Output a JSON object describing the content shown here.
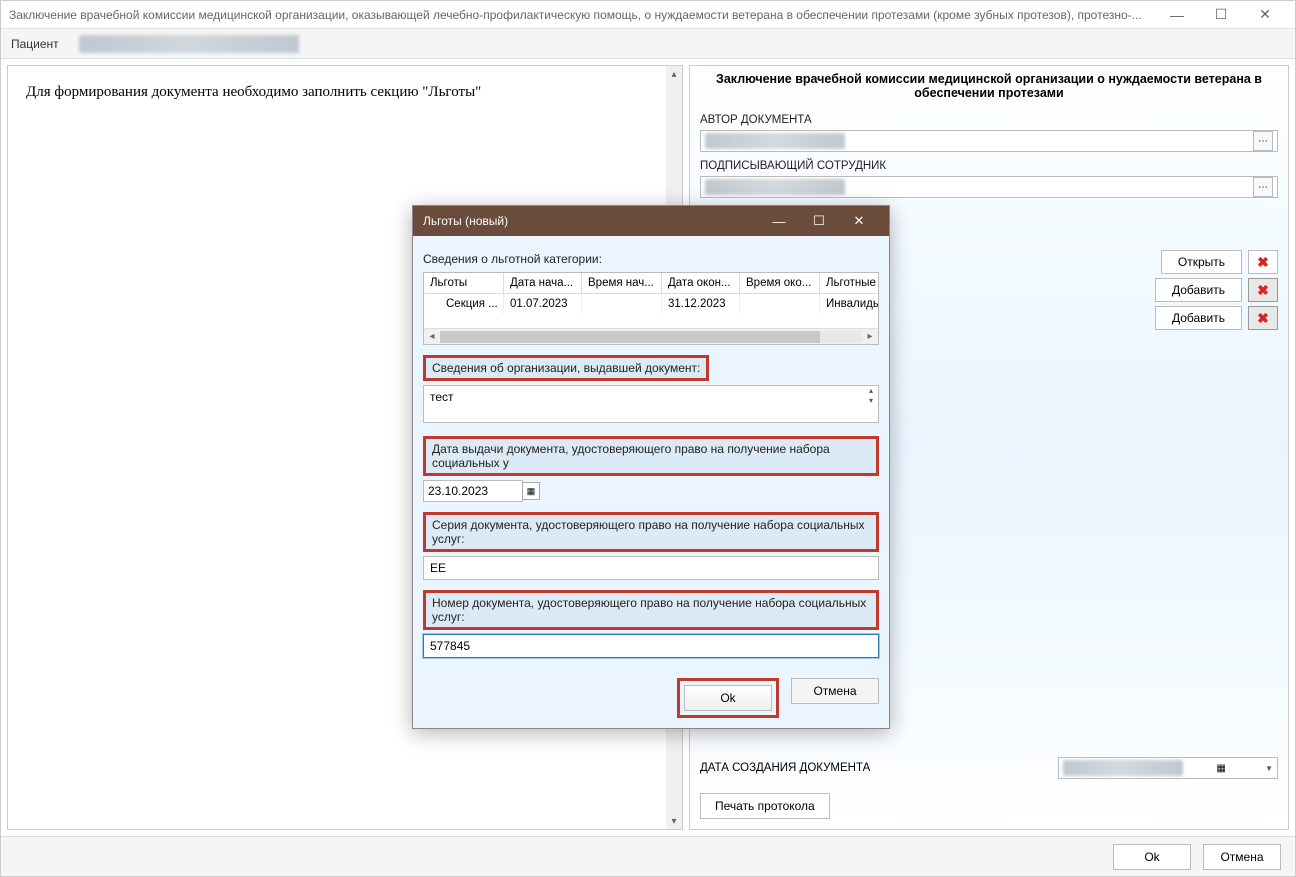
{
  "window": {
    "title": "Заключение врачебной комиссии медицинской организации, оказывающей лечебно-профилактическую помощь, о нуждаемости ветерана в обеспечении протезами (кроме зубных протезов), протезно-..."
  },
  "toolbar": {
    "patient_label": "Пациент"
  },
  "left": {
    "prompt": "Для формирования документа необходимо заполнить секцию \"Льготы\""
  },
  "right": {
    "title": "Заключение врачебной комиссии медицинской организации о нуждаемости ветерана в обеспечении протезами",
    "author_label": "АВТОР ДОКУМЕНТА",
    "signer_label": "ПОДПИСЫВАЮЩИЙ СОТРУДНИК",
    "open_btn": "Открыть",
    "add_btn": "Добавить",
    "date_created_label": "ДАТА СОЗДАНИЯ ДОКУМЕНТА",
    "print_btn": "Печать протокола"
  },
  "footer": {
    "ok": "Ok",
    "cancel": "Отмена"
  },
  "modal": {
    "title": "Льготы (новый)",
    "section1": "Сведения о льготной категории:",
    "grid": {
      "columns": [
        "Льготы",
        "Дата нача...",
        "Время нач...",
        "Дата окон...",
        "Время око...",
        "Льготные"
      ],
      "row": [
        "Секция ...",
        "01.07.2023",
        "",
        "31.12.2023",
        "",
        "Инвалиды"
      ]
    },
    "org_label": "Сведения об организации, выдавшей документ:",
    "org_value": "тест",
    "date_label": "Дата выдачи документа, удостоверяющего право на получение набора социальных у",
    "date_value": "23.10.2023",
    "series_label": "Серия документа, удостоверяющего право на получение набора социальных услуг:",
    "series_value": "ЕЕ",
    "number_label": "Номер документа, удостоверяющего право на получение набора социальных услуг:",
    "number_value": "577845",
    "ok": "Ok",
    "cancel": "Отмена"
  }
}
